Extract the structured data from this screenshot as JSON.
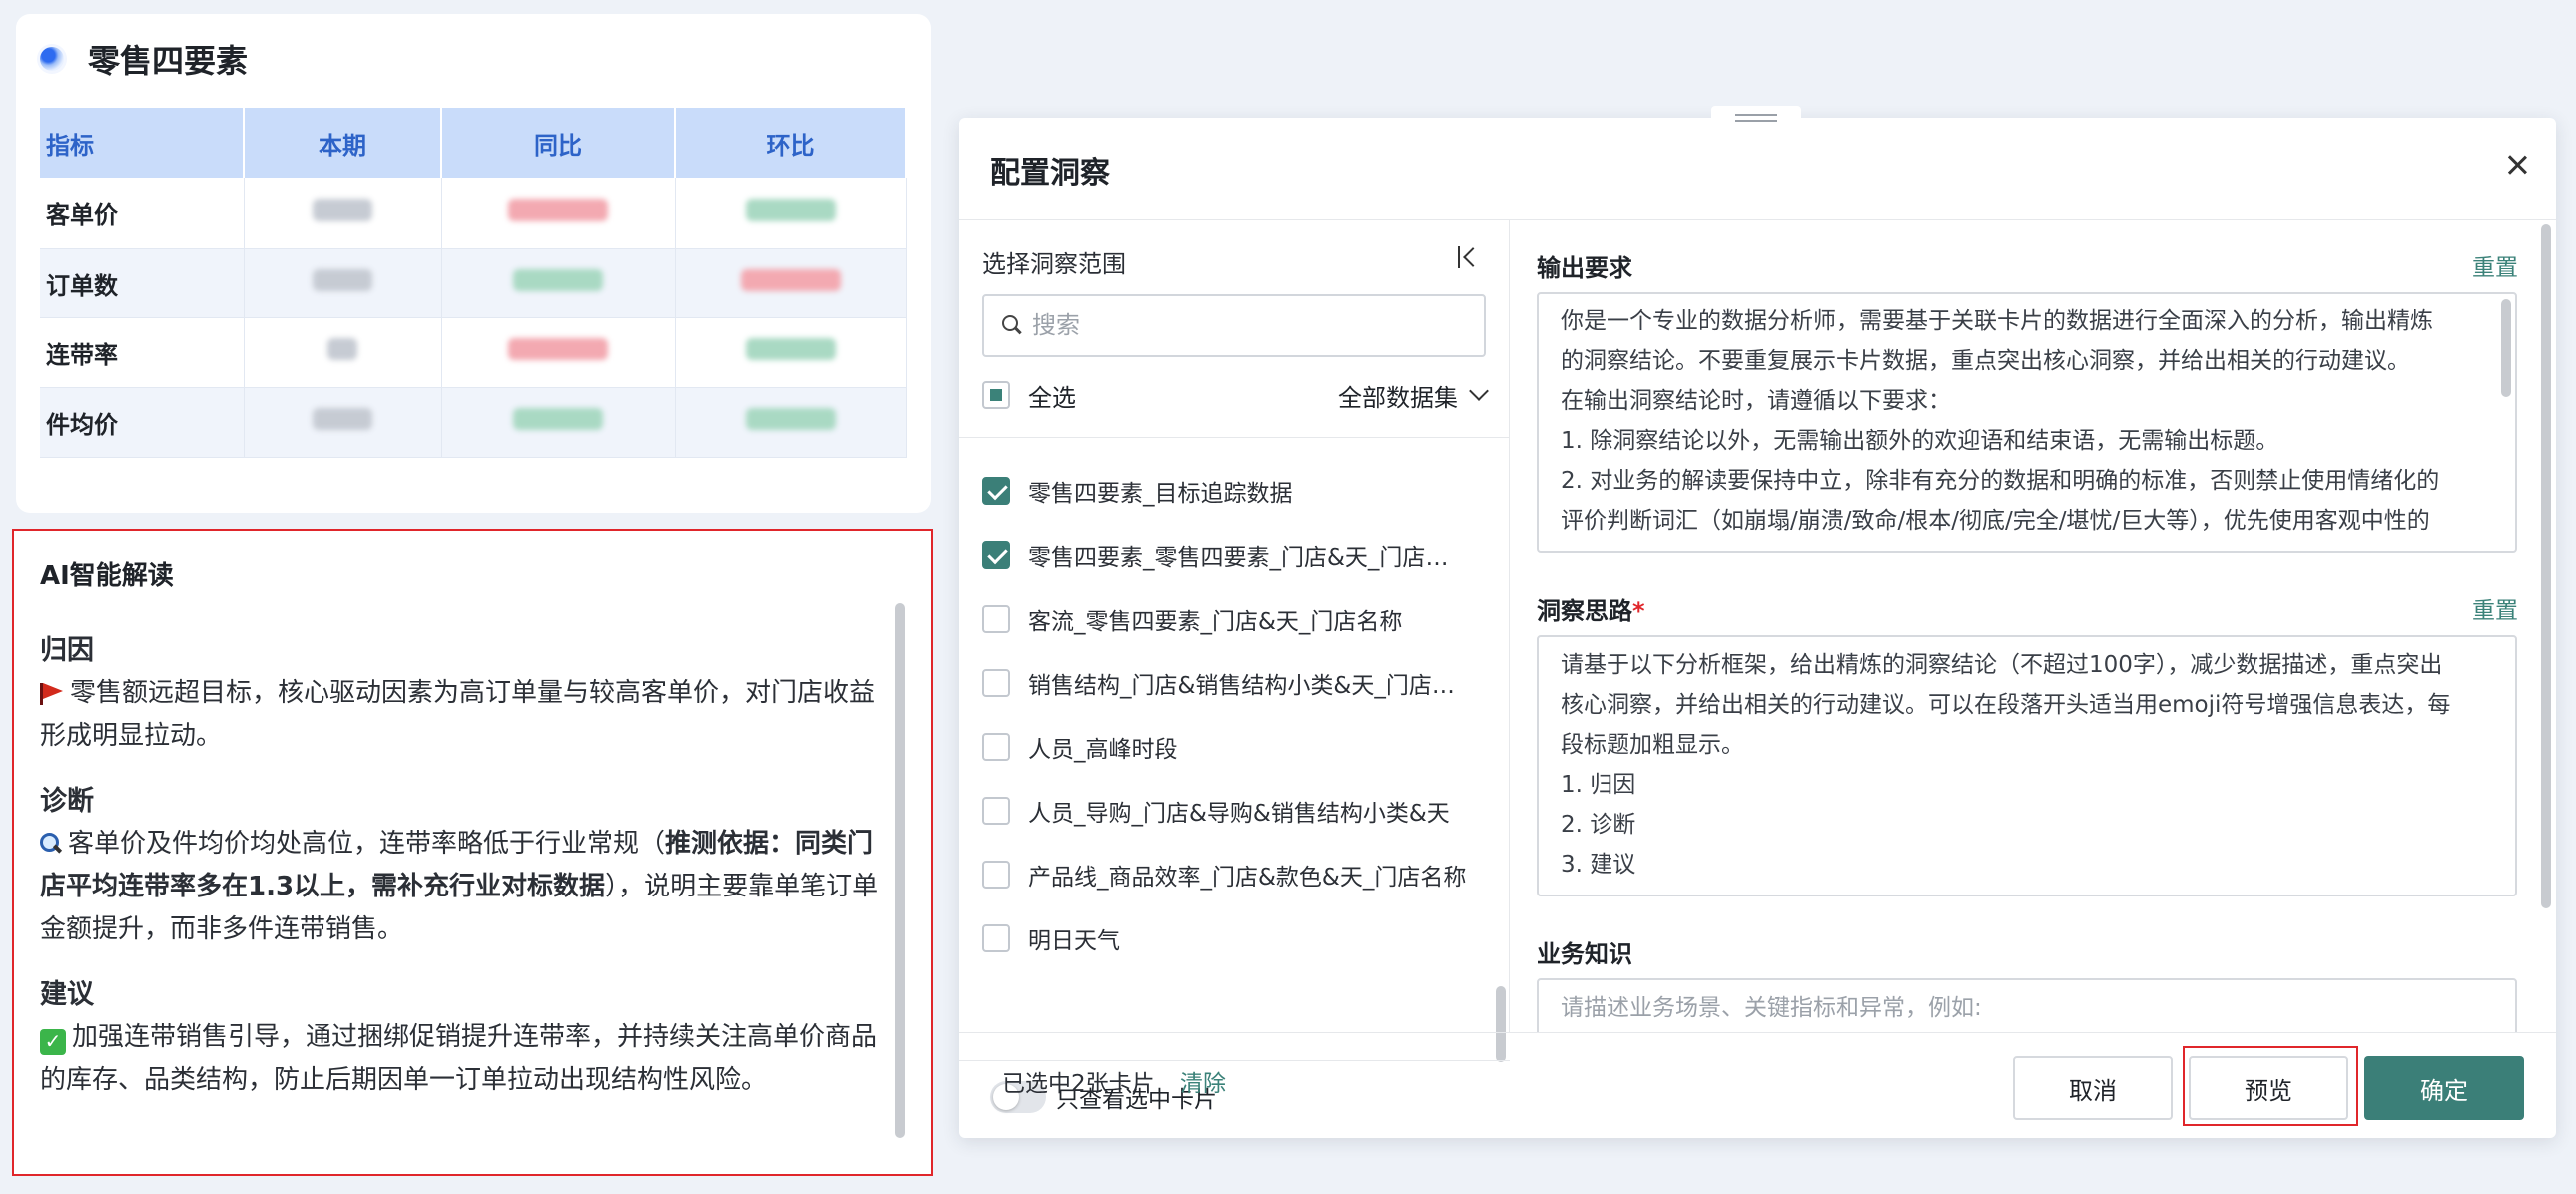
{
  "top_card": {
    "title": "零售四要素",
    "table": {
      "headers": [
        "指标",
        "本期",
        "同比",
        "环比"
      ],
      "rows": [
        "客单价",
        "订单数",
        "连带率",
        "件均价"
      ]
    }
  },
  "ai_card": {
    "title": "AI智能解读",
    "sections": [
      {
        "heading": "归因",
        "icon": "flag-icon",
        "text": "零售额远超目标，核心驱动因素为高订单量与较高客单价，对门店收益形成明显拉动。"
      },
      {
        "heading": "诊断",
        "icon": "magnifier-icon",
        "text_before": "客单价及件均价均处高位，连带率略低于行业常规（",
        "text_bold": "推测依据：同类门店平均连带率多在1.3以上，需补充行业对标数据",
        "text_after": "），说明主要靠单笔订单金额提升，而非多件连带销售。"
      },
      {
        "heading": "建议",
        "icon": "check-icon",
        "text": "加强连带销售引导，通过捆绑促销提升连带率，并持续关注高单价商品的库存、品类结构，防止后期因单一订单拉动出现结构性风险。"
      }
    ]
  },
  "dialog": {
    "title": "配置洞察",
    "scope_label": "选择洞察范围",
    "search_placeholder": "搜索",
    "select_all_label": "全选",
    "dataset_select": "全部数据集",
    "cards": [
      {
        "label": "零售四要素_目标追踪数据",
        "checked": true
      },
      {
        "label": "零售四要素_零售四要素_门店&天_门店名称",
        "checked": true
      },
      {
        "label": "客流_零售四要素_门店&天_门店名称",
        "checked": false
      },
      {
        "label": "销售结构_门店&销售结构小类&天_门店名称",
        "checked": false
      },
      {
        "label": "人员_高峰时段",
        "checked": false
      },
      {
        "label": "人员_导购_门店&导购&销售结构小类&天",
        "checked": false
      },
      {
        "label": "产品线_商品效率_门店&款色&天_门店名称",
        "checked": false
      },
      {
        "label": "明日天气",
        "checked": false
      }
    ],
    "only_selected_label": "只查看选中卡片",
    "output_req": {
      "label": "输出要求",
      "reset": "重置",
      "lines": [
        "你是一个专业的数据分析师，需要基于关联卡片的数据进行全面深入的分析，输出精炼",
        "的洞察结论。不要重复展示卡片数据，重点突出核心洞察，并给出相关的行动建议。",
        "在输出洞察结论时，请遵循以下要求：",
        "1. 除洞察结论以外，无需输出额外的欢迎语和结束语，无需输出标题。",
        "2. 对业务的解读要保持中立，除非有充分的数据和明确的标准，否则禁止使用情绪化的",
        "评价判断词汇（如崩塌/崩溃/致命/根本/彻底/完全/堪忧/巨大等），优先使用客观中性的"
      ]
    },
    "insight_idea": {
      "label": "洞察思路",
      "required_mark": "*",
      "reset": "重置",
      "lines": [
        "请基于以下分析框架，给出精炼的洞察结论（不超过100字），减少数据描述，重点突出",
        "核心洞察，并给出相关的行动建议。可以在段落开头适当用emoji符号增强信息表达，每",
        "段标题加粗显示。",
        "1. 归因",
        "2. 诊断",
        "3. 建议"
      ]
    },
    "business_knowledge": {
      "label": "业务知识",
      "placeholder": "请描述业务场景、关键指标和异常，例如:"
    },
    "footer": {
      "selected_count": "已选中2张卡片",
      "clear": "清除",
      "cancel": "取消",
      "preview": "预览",
      "ok": "确定"
    }
  }
}
